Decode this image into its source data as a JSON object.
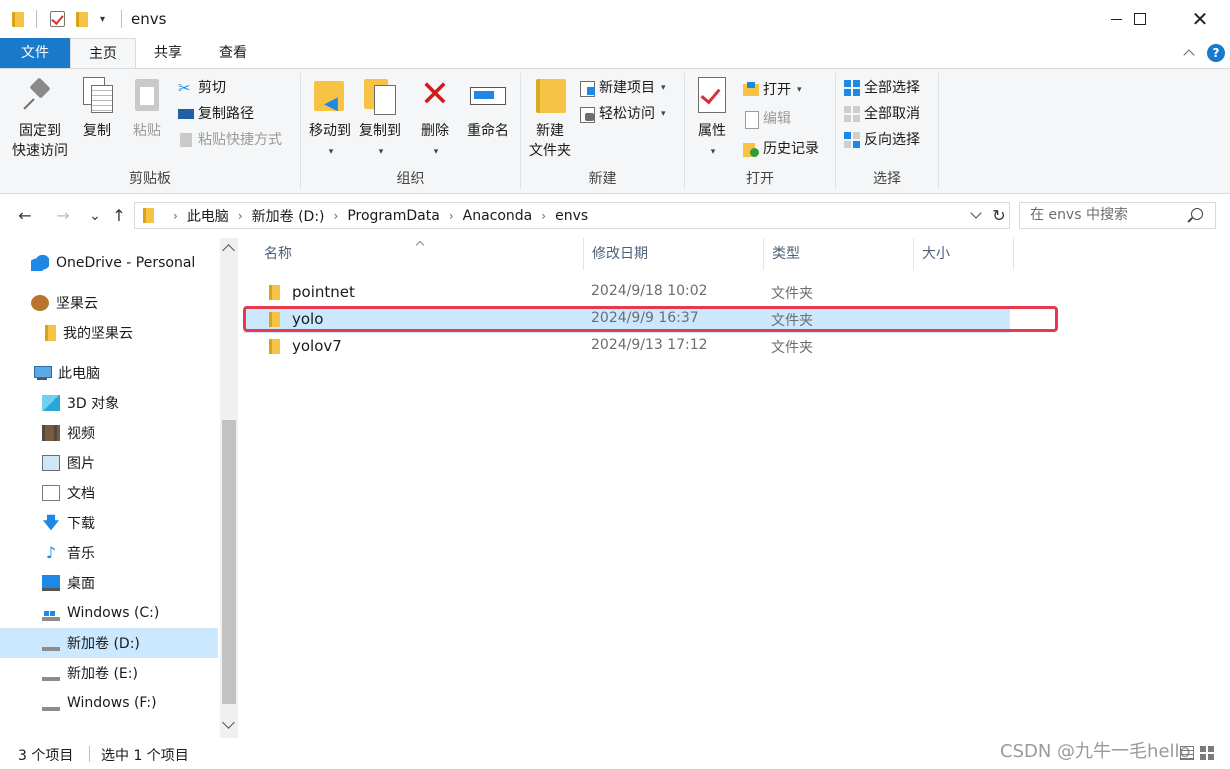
{
  "window": {
    "title": "envs",
    "close_glyph": "✕",
    "qa_down_glyph": "▾"
  },
  "tabs": {
    "file": "文件",
    "home": "主页",
    "share": "共享",
    "view": "查看",
    "help_glyph": "?"
  },
  "ribbon": {
    "clipboard": {
      "label": "剪贴板",
      "pin": [
        "固定到",
        "快速访问"
      ],
      "copy": "复制",
      "paste": "粘贴",
      "cut": "剪切",
      "copy_path": "复制路径",
      "paste_shortcut": "粘贴快捷方式",
      "cut_glyph": "✂"
    },
    "organize": {
      "label": "组织",
      "move_to": "移动到",
      "copy_to": "复制到",
      "delete": "删除",
      "rename": "重命名",
      "delete_glyph": "✕"
    },
    "new": {
      "label": "新建",
      "new_folder": [
        "新建",
        "文件夹"
      ],
      "new_item": "新建项目",
      "easy_access": "轻松访问"
    },
    "open": {
      "label": "打开",
      "properties": "属性",
      "open": "打开",
      "edit": "编辑",
      "history": "历史记录"
    },
    "select": {
      "label": "选择",
      "select_all": "全部选择",
      "select_none": "全部取消",
      "invert": "反向选择"
    },
    "dropdown_glyph": "▾"
  },
  "nav": {
    "back_glyph": "←",
    "forward_glyph": "→",
    "recent_glyph": "⌄",
    "up_glyph": "↑",
    "refresh_glyph": "↻",
    "crumb_sep": "›",
    "breadcrumb": [
      "此电脑",
      "新加卷 (D:)",
      "ProgramData",
      "Anaconda",
      "envs"
    ],
    "search_placeholder": "在 envs 中搜索"
  },
  "sidebar": {
    "items": [
      {
        "label": "OneDrive - Personal",
        "icon": "cloud-icon"
      },
      {
        "label": "坚果云",
        "icon": "nut-icon"
      },
      {
        "label": "我的坚果云",
        "icon": "folder-icon"
      },
      {
        "label": "此电脑",
        "icon": "computer-icon"
      },
      {
        "label": "3D 对象",
        "icon": "cube-icon"
      },
      {
        "label": "视频",
        "icon": "video-icon"
      },
      {
        "label": "图片",
        "icon": "picture-icon"
      },
      {
        "label": "文档",
        "icon": "document-icon"
      },
      {
        "label": "下载",
        "icon": "download-icon"
      },
      {
        "label": "音乐",
        "icon": "music-icon"
      },
      {
        "label": "桌面",
        "icon": "desktop-icon"
      },
      {
        "label": "Windows (C:)",
        "icon": "drive-icon"
      },
      {
        "label": "新加卷 (D:)",
        "icon": "drive-icon"
      },
      {
        "label": "新加卷 (E:)",
        "icon": "drive-icon"
      },
      {
        "label": "Windows (F:)",
        "icon": "drive-icon"
      }
    ],
    "download_glyph": "🡇",
    "music_glyph": "♪"
  },
  "filelist": {
    "columns": [
      "名称",
      "修改日期",
      "类型",
      "大小"
    ],
    "rows": [
      {
        "name": "pointnet",
        "date": "2024/9/18 10:02",
        "type": "文件夹"
      },
      {
        "name": "yolo",
        "date": "2024/9/9 16:37",
        "type": "文件夹"
      },
      {
        "name": "yolov7",
        "date": "2024/9/13 17:12",
        "type": "文件夹"
      }
    ]
  },
  "status": {
    "count": "3 个项目",
    "selected": "选中 1 个项目"
  },
  "watermark": "CSDN @九牛一毛hello",
  "colors": {
    "accent": "#1979ca",
    "selection": "#cce8ff",
    "highlight_box": "#e8384f",
    "folder": "#f6c344"
  }
}
